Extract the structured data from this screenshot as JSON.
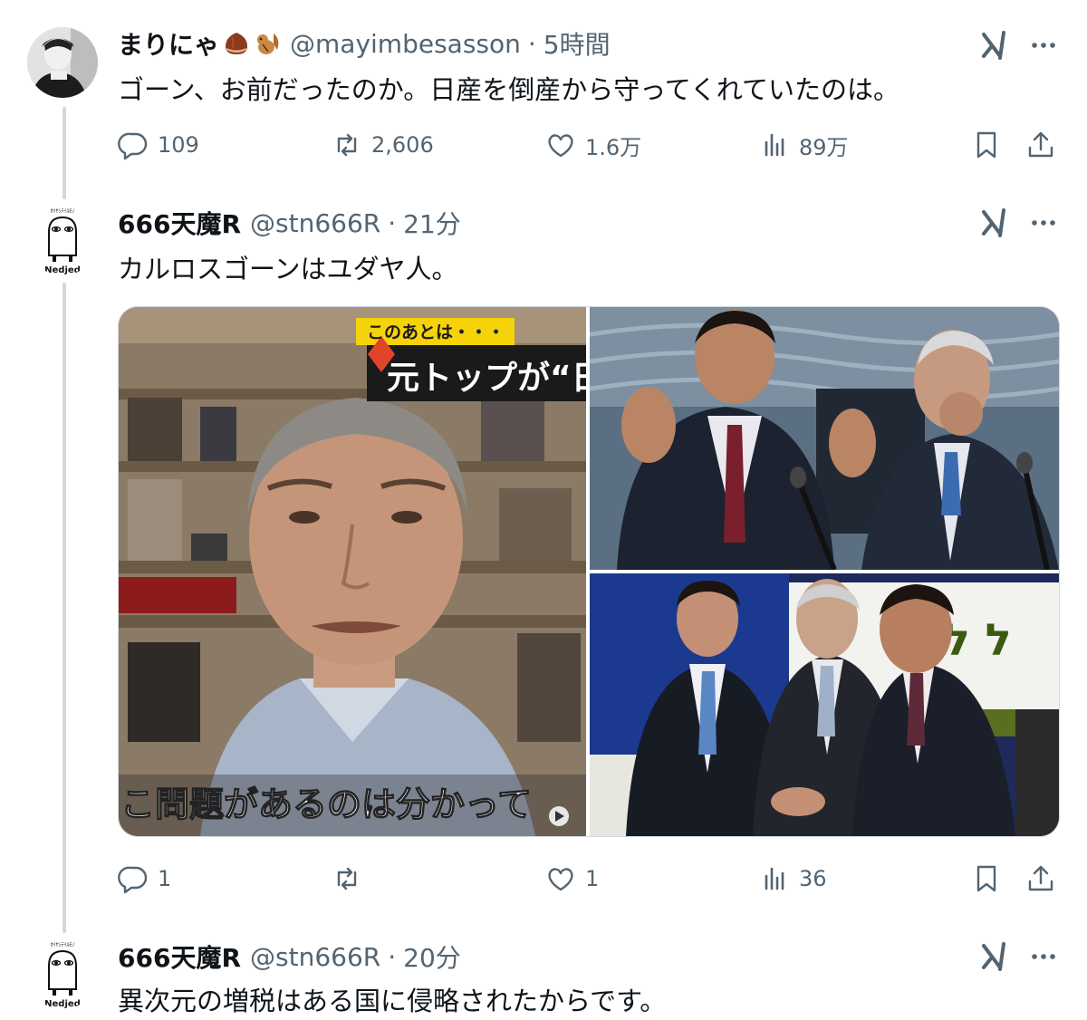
{
  "tweets": [
    {
      "name": "まりにゃ",
      "handle": "@mayimbesasson",
      "time": "5時間",
      "text": "ゴーン、お前だったのか。日産を倒産から守ってくれていたのは。",
      "stats": {
        "reply": "109",
        "retweet": "2,606",
        "like": "1.6万",
        "views": "89万"
      }
    },
    {
      "name": "666天魔R",
      "handle": "@stn666R",
      "time": "21分",
      "text": "カルロスゴーンはユダヤ人。",
      "media": {
        "caption_badge": "このあとは・・・",
        "caption_headline": "元トップが“日",
        "subtitle": "こ問題があるのは分かって"
      },
      "stats": {
        "reply": "1",
        "retweet": "",
        "like": "1",
        "views": "36"
      }
    },
    {
      "name": "666天魔R",
      "handle": "@stn666R",
      "time": "20分",
      "text": "異次元の増税はある国に侵略されたからです。"
    }
  ],
  "mascot_label": "Nedjed",
  "dot": "·",
  "colors": {
    "text": "#0f1419",
    "secondary": "#536471",
    "thread_line": "#cfd9de",
    "caption_yellow": "#f5d20a"
  },
  "icons": [
    "grok-icon",
    "more-icon",
    "reply-icon",
    "retweet-icon",
    "like-icon",
    "views-icon",
    "bookmark-icon",
    "share-icon"
  ]
}
